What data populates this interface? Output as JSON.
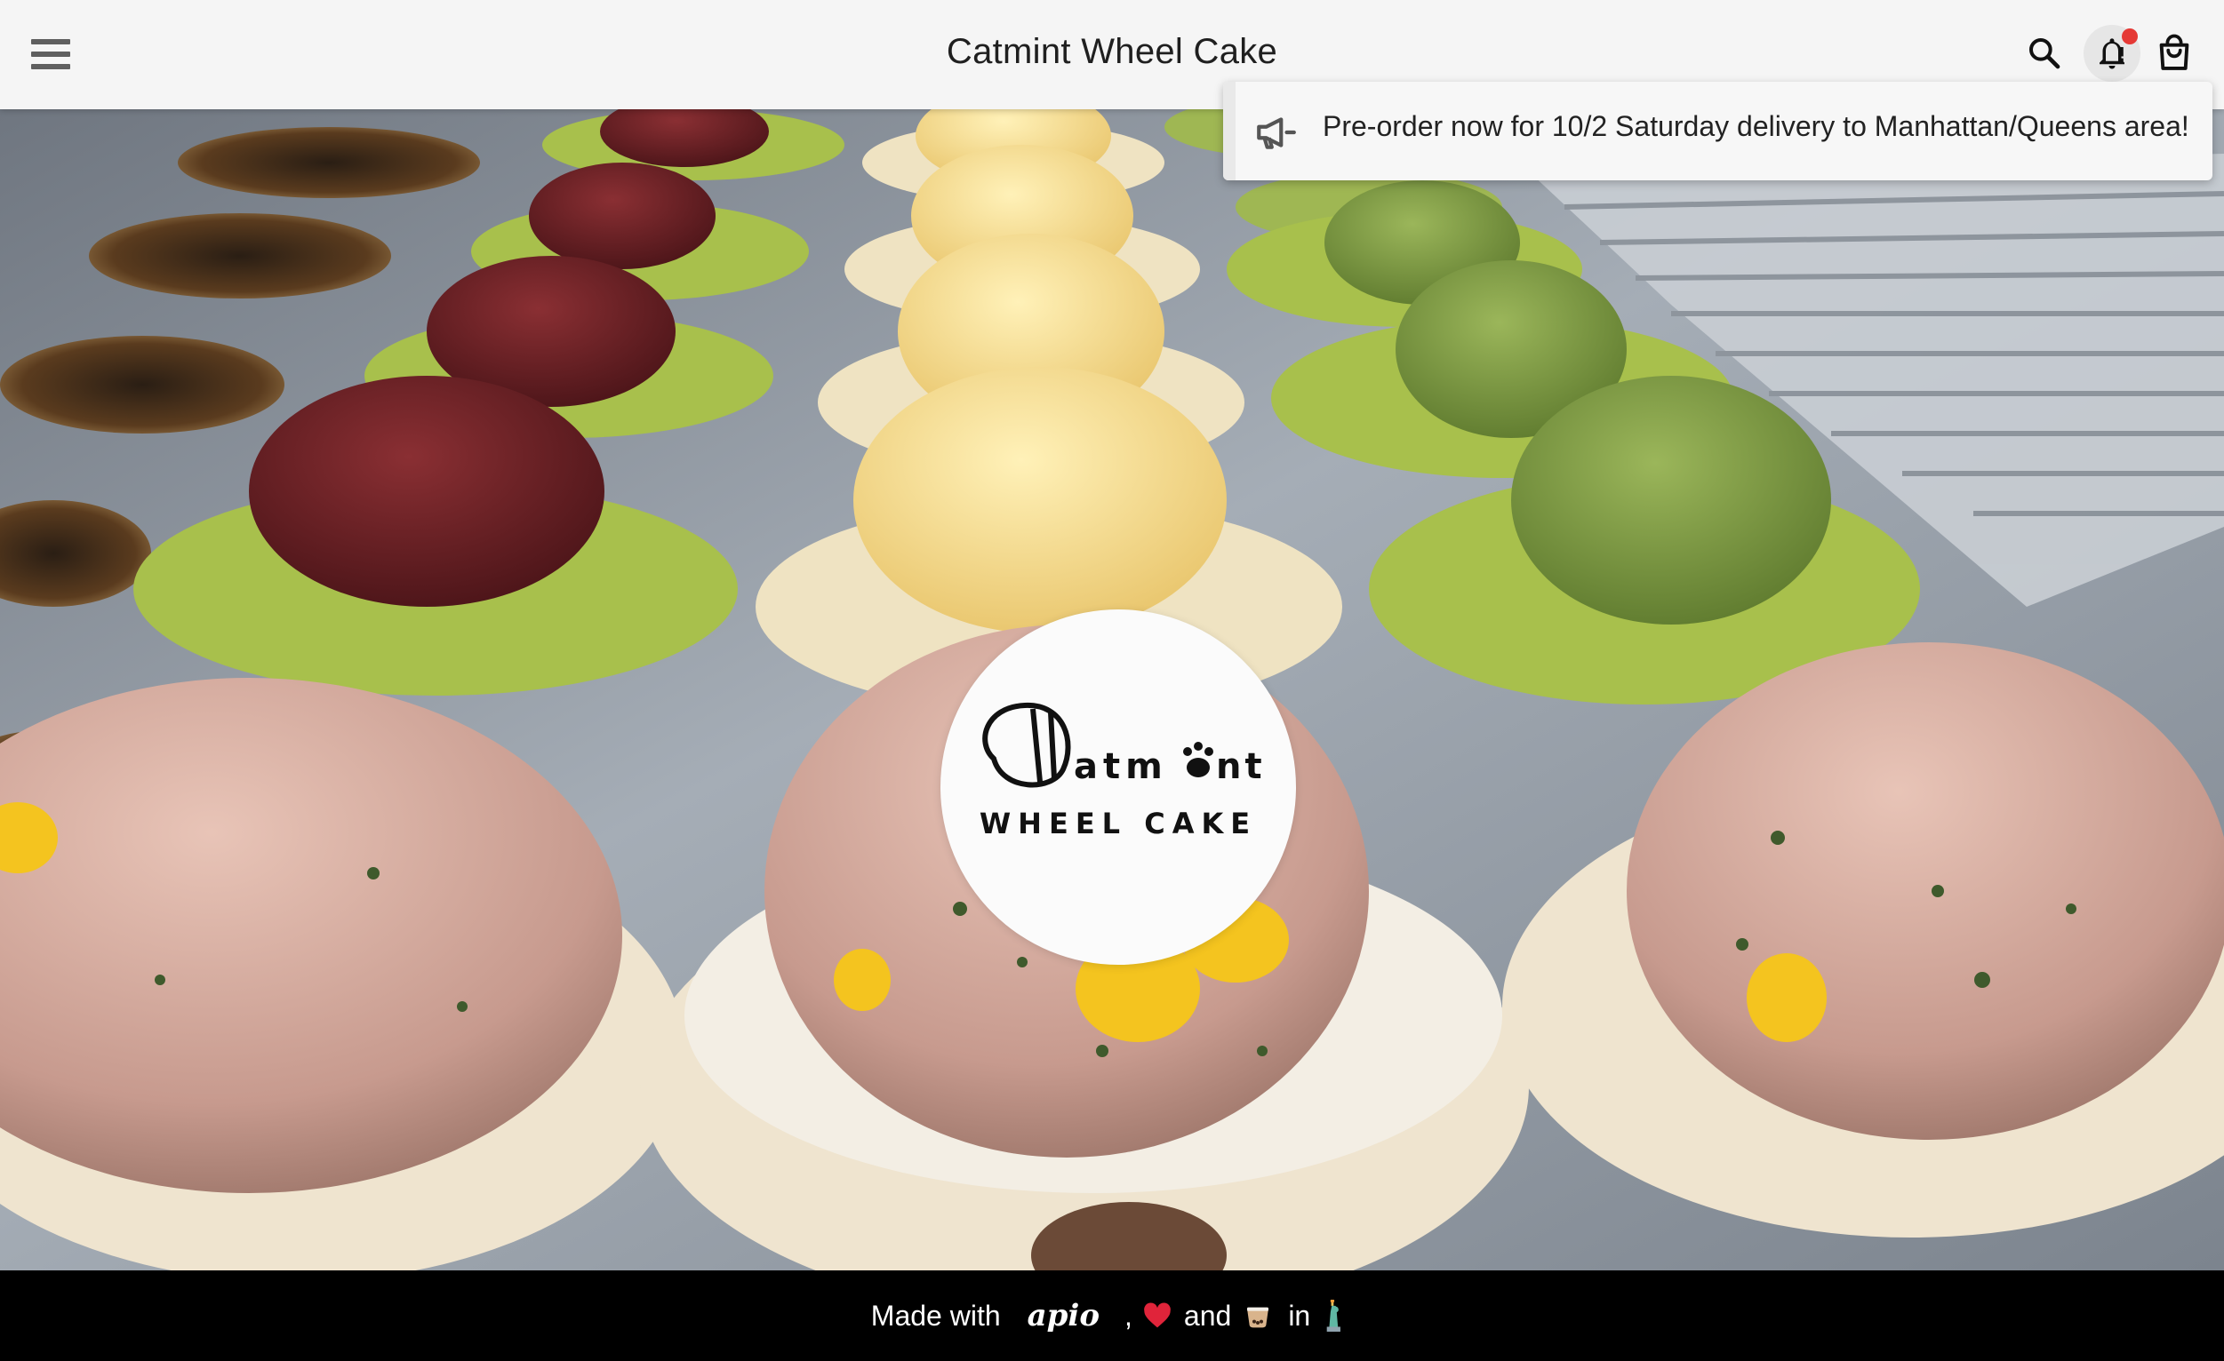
{
  "app": {
    "title": "Catmint Wheel Cake"
  },
  "header": {
    "menu_icon": "hamburger-menu-icon",
    "search_icon": "search-icon",
    "notifications_icon": "bell-icon",
    "notifications_has_unread": true,
    "cart_icon": "shopping-bag-icon"
  },
  "notification": {
    "icon": "megaphone-icon",
    "text": "Pre-order now for 10/2 Saturday delivery to Manhattan/Queens area!"
  },
  "hero": {
    "logo": {
      "line1": "Catmint",
      "line2": "WHEEL CAKE"
    }
  },
  "footer": {
    "made_with": "Made with",
    "brand": "apio",
    "comma": ",",
    "heart_icon": "red-heart-emoji",
    "and": "and",
    "drink_icon": "bubble-tea-emoji",
    "in": "in",
    "statue_icon": "statue-of-liberty-emoji"
  },
  "colors": {
    "header_bg": "#f5f5f5",
    "footer_bg": "#000000",
    "badge": "#e53935",
    "text_primary": "#1f1f1f"
  }
}
